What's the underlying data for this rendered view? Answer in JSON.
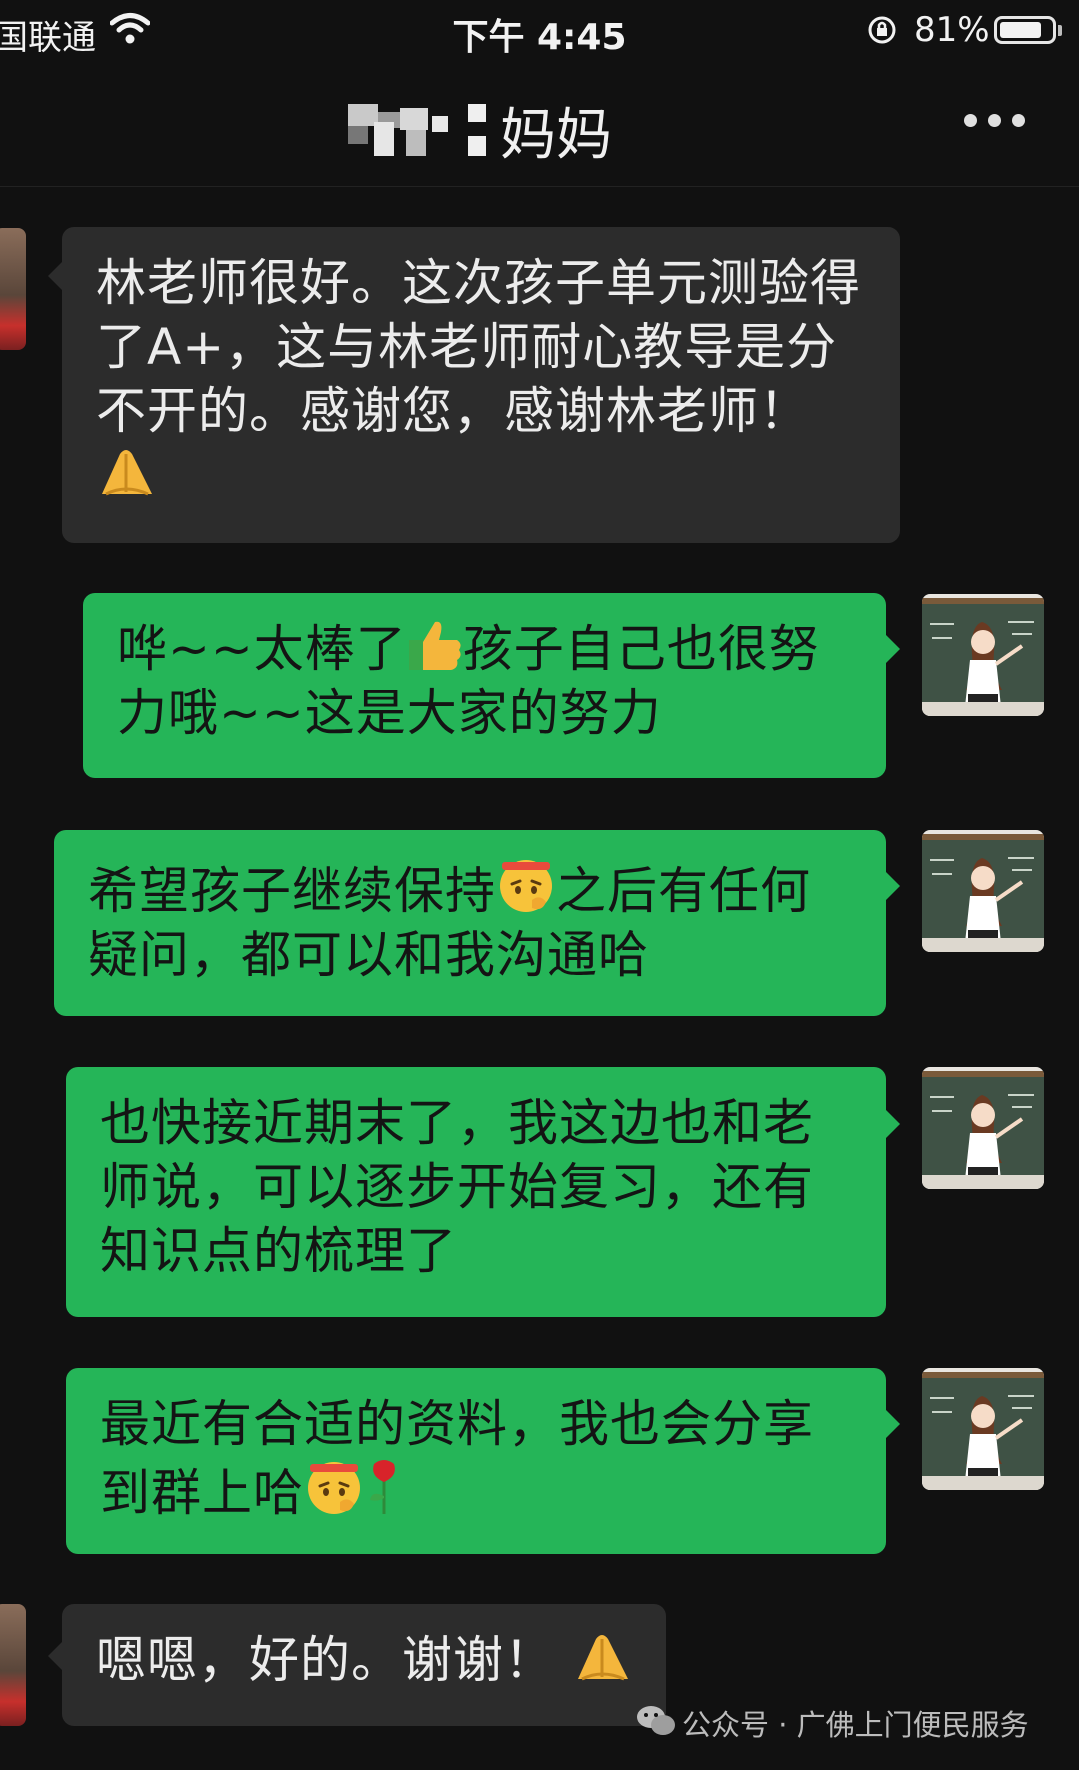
{
  "status_bar": {
    "carrier": "国联通",
    "time": "下午 4:45",
    "battery_percent": "81%",
    "battery_level": 0.81
  },
  "header": {
    "title": "妈妈",
    "more_icon": "more-dots-icon"
  },
  "messages": [
    {
      "side": "in",
      "text": "林老师很好。这次孩子单元测验得了A+，这与林老师耐心教导是分不开的。感谢您，感谢林老师！",
      "emoji": "folded-hands"
    },
    {
      "side": "out",
      "text_before": "哗~~太棒了",
      "emoji": "thumbs-up",
      "text_after": "孩子自己也很努力哦~~这是大家的努力"
    },
    {
      "side": "out",
      "text_before": "希望孩子继续保持",
      "emoji": "salute-face",
      "text_after": "之后有任何疑问，都可以和我沟通哈"
    },
    {
      "side": "out",
      "text": "也快接近期末了，我这边也和老师说，可以逐步开始复习，还有知识点的梳理了"
    },
    {
      "side": "out",
      "text_before": "最近有合适的资料，我也会分享到群上哈",
      "emoji": "salute-face",
      "emoji2": "rose"
    },
    {
      "side": "in",
      "text": "嗯嗯，好的。谢谢！",
      "emoji": "folded-hands"
    }
  ],
  "watermark": {
    "text": "公众号 · 广佛上门便民服务",
    "icon": "wechat-icon"
  },
  "colors": {
    "background": "#111111",
    "incoming_bubble": "#2c2c2c",
    "outgoing_bubble": "#25b558"
  }
}
